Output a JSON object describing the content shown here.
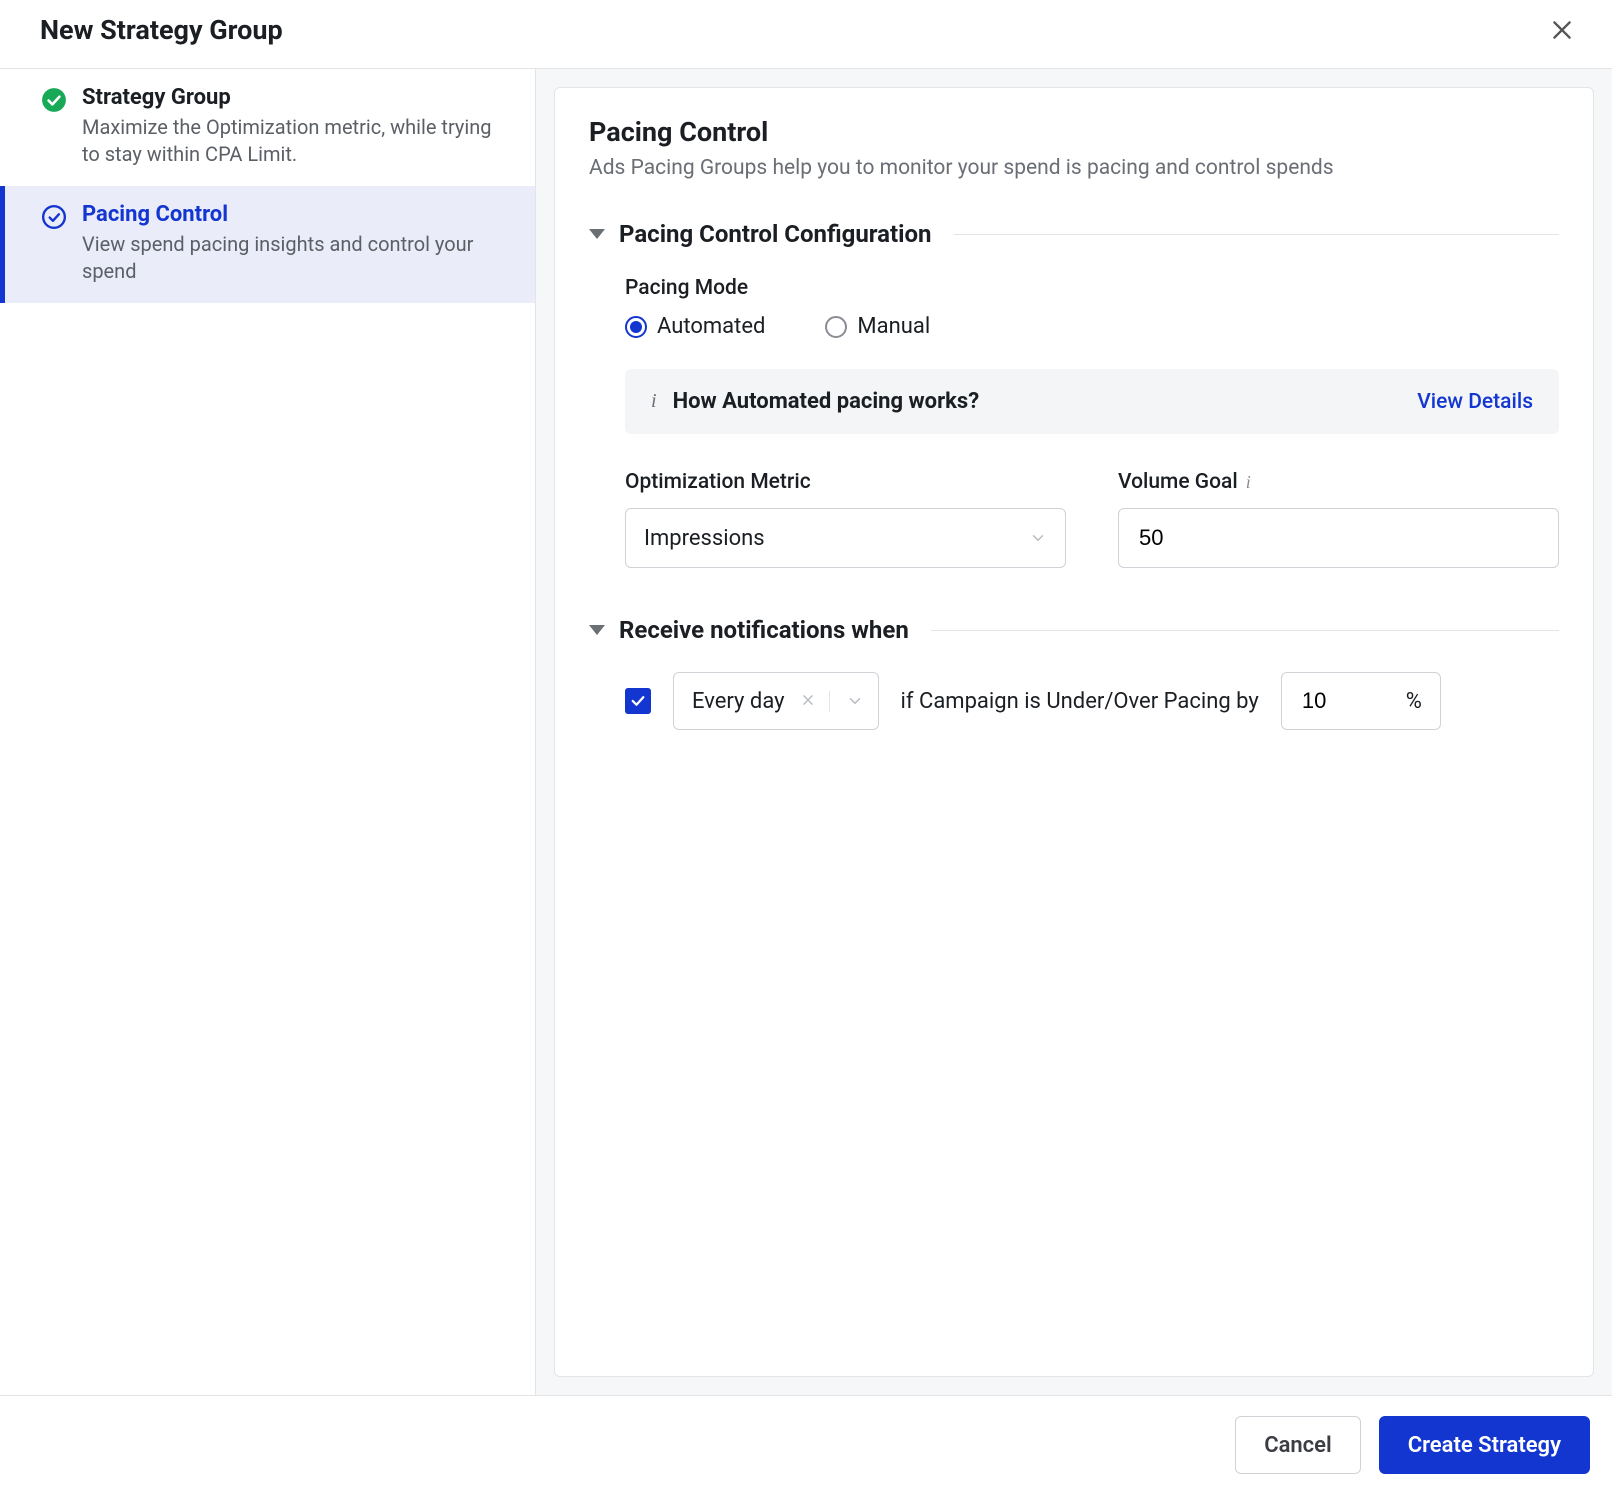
{
  "header": {
    "title": "New Strategy Group"
  },
  "sidebar": {
    "steps": [
      {
        "title": "Strategy Group",
        "desc": "Maximize the Optimization metric, while trying to stay within CPA Limit."
      },
      {
        "title": "Pacing Control",
        "desc": "View spend pacing insights and control your spend"
      }
    ]
  },
  "page": {
    "title": "Pacing Control",
    "subtitle": "Ads Pacing Groups help you to monitor your spend is pacing and control spends"
  },
  "sections": {
    "config": {
      "title": "Pacing Control Configuration",
      "pacing_mode_label": "Pacing Mode",
      "pacing_modes": {
        "automated": "Automated",
        "manual": "Manual"
      },
      "banner": {
        "title": "How Automated pacing works?",
        "link": "View Details"
      },
      "optimization_metric_label": "Optimization Metric",
      "optimization_metric_value": "Impressions",
      "volume_goal_label": "Volume Goal",
      "volume_goal_value": "50"
    },
    "notifications": {
      "title": "Receive notifications when",
      "frequency_value": "Every day",
      "condition_text": "if Campaign is Under/Over Pacing by",
      "threshold_value": "10",
      "threshold_unit": "%"
    }
  },
  "footer": {
    "cancel": "Cancel",
    "create": "Create Strategy"
  }
}
